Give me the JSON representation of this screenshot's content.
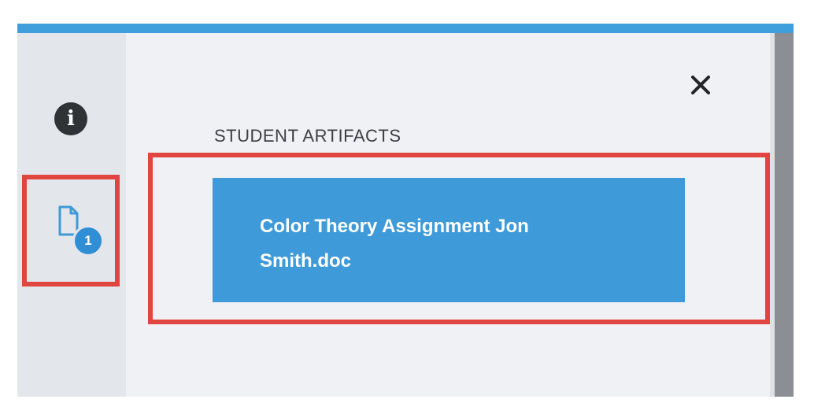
{
  "sidebar": {
    "info_glyph": "i",
    "artifacts_count": "1"
  },
  "panel": {
    "section_title": "STUDENT ARTIFACTS",
    "close_glyph": "×",
    "artifacts": [
      {
        "name": "Color Theory Assignment Jon Smith.doc"
      }
    ]
  },
  "colors": {
    "accent_blue": "#3f9fdc",
    "card_blue": "#3e9ad8",
    "highlight_red": "#e0463f",
    "panel_bg": "#eff1f4",
    "rail_bg": "#e3e6ea"
  },
  "icons": [
    "info-icon",
    "document-icon",
    "close-icon"
  ]
}
